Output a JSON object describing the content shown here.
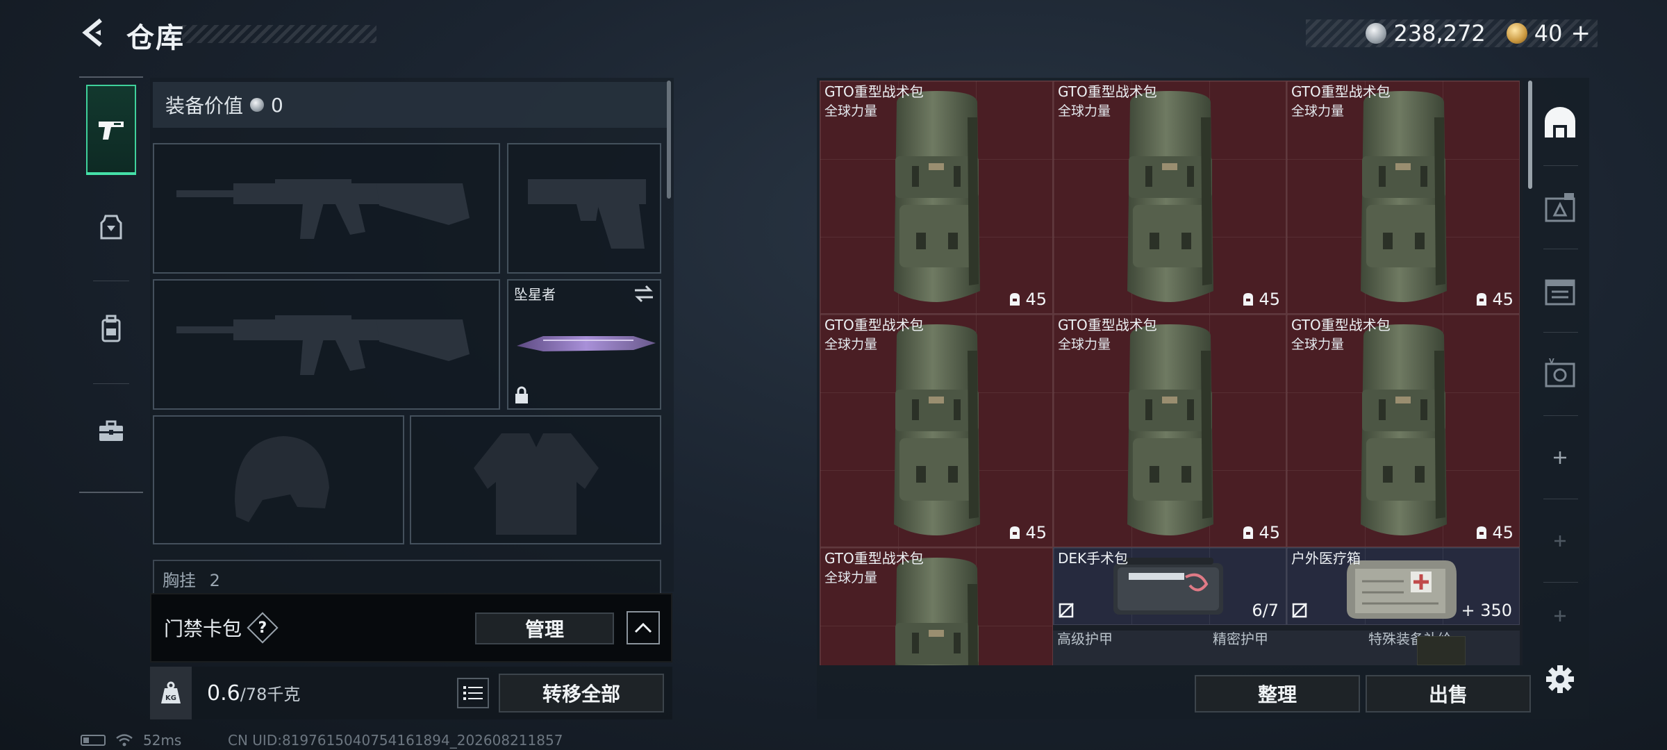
{
  "header": {
    "title": "仓库",
    "currency_silver": "238,272",
    "currency_gold": "40",
    "currency_add": "+"
  },
  "equipment": {
    "value_label": "装备价值",
    "value": "0",
    "melee_name": "坠星者",
    "chest_label": "胸挂",
    "chest_count": "2"
  },
  "access_card": {
    "label": "门禁卡包",
    "help": "?",
    "manage_label": "管理"
  },
  "weight": {
    "current": "0.6",
    "capacity": "/78千克",
    "transfer_all_label": "转移全部"
  },
  "stash": {
    "items": [
      {
        "name": "GTO重型战术包",
        "brand": "全球力量",
        "count": "45"
      },
      {
        "name": "GTO重型战术包",
        "brand": "全球力量",
        "count": "45"
      },
      {
        "name": "GTO重型战术包",
        "brand": "全球力量",
        "count": "45"
      },
      {
        "name": "GTO重型战术包",
        "brand": "全球力量",
        "count": "45"
      },
      {
        "name": "GTO重型战术包",
        "brand": "全球力量",
        "count": "45"
      },
      {
        "name": "GTO重型战术包",
        "brand": "全球力量",
        "count": "45"
      },
      {
        "name": "GTO重型战术包",
        "brand": "全球力量",
        "count": ""
      }
    ],
    "medkit": {
      "name": "DEK手术包",
      "count": "6/7"
    },
    "field_medkit": {
      "name": "户外医疗箱",
      "count": "350",
      "prefix": "+"
    },
    "categories": [
      "高级护甲",
      "精密护甲",
      "特殊装备补给"
    ],
    "arrange_label": "整理",
    "sell_label": "出售"
  },
  "status": {
    "ping": "52ms",
    "uid": "CN UID:8197615040754161894_202608211857"
  },
  "colors": {
    "accent_green": "#3fd19b",
    "item_rarity_red": "#4a1e24",
    "item_rarity_blue": "#262a3e"
  }
}
